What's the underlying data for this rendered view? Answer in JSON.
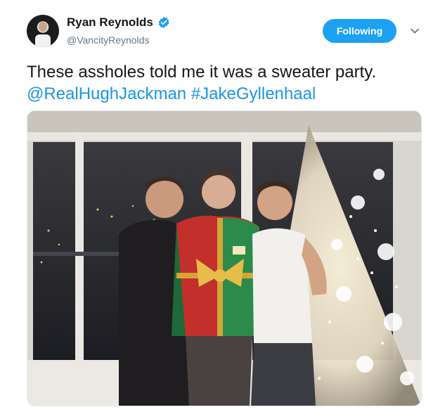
{
  "tweet": {
    "author": {
      "display_name": "Ryan Reynolds",
      "handle": "@VancityReynolds"
    },
    "follow_button_label": "Following",
    "text": {
      "main": "These assholes told me it was a sweater party.",
      "mentions": "@RealHughJackman",
      "hashtag": "#JakeGyllenhaal"
    },
    "media": {
      "type": "photo"
    }
  },
  "colors": {
    "accent": "#1da1f2",
    "link": "#1b95e0",
    "verified": "#1da1f2",
    "secondary_text": "#657786"
  },
  "icons": [
    "verified-badge-icon",
    "chevron-down-icon"
  ]
}
